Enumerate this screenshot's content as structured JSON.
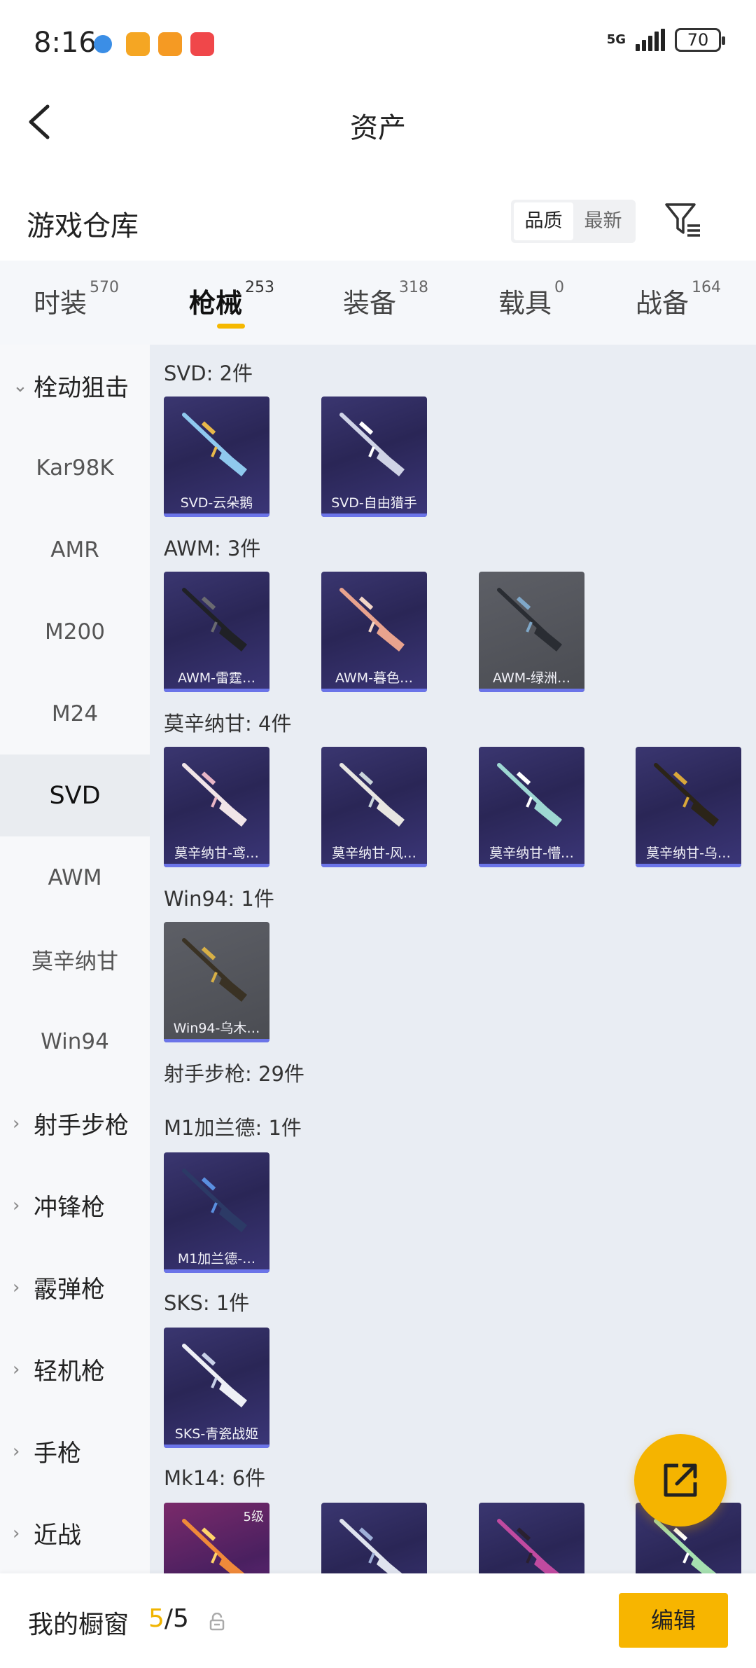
{
  "status": {
    "time": "8:16",
    "network": "5G",
    "battery": "70",
    "app_icons": [
      {
        "name": "browser-app-icon",
        "color": "#3b8ee6"
      },
      {
        "name": "yellow-app-icon",
        "color": "#f5a623"
      },
      {
        "name": "video-app-icon",
        "color": "#f59a23"
      },
      {
        "name": "red-app-icon",
        "color": "#f0474a"
      }
    ]
  },
  "nav": {
    "title": "资产"
  },
  "header": {
    "title": "游戏仓库",
    "sort_options": [
      "品质",
      "最新"
    ],
    "sort_selected": "品质"
  },
  "tabs": [
    {
      "label": "时装",
      "count": "570"
    },
    {
      "label": "枪械",
      "count": "253",
      "active": true
    },
    {
      "label": "装备",
      "count": "318"
    },
    {
      "label": "载具",
      "count": "0"
    },
    {
      "label": "战备",
      "count": "164"
    }
  ],
  "sidebar": {
    "expanded_category": "栓动狙击",
    "sub_items": [
      "Kar98K",
      "AMR",
      "M200",
      "M24",
      "SVD",
      "AWM",
      "莫辛纳甘",
      "Win94"
    ],
    "active_item": "SVD",
    "categories": [
      "射手步枪",
      "冲锋枪",
      "霰弹枪",
      "轻机枪",
      "手枪",
      "近战"
    ]
  },
  "groups": [
    {
      "label": "SVD: 2件",
      "items": [
        {
          "name": "SVD-云朵鹅",
          "tone": "purple",
          "gun": "#8fc9ee",
          "accent": "#e8b84a"
        },
        {
          "name": "SVD-自由猎手",
          "tone": "purple",
          "gun": "#cfd3e6",
          "accent": "#ffffff"
        }
      ]
    },
    {
      "label": "AWM: 3件",
      "items": [
        {
          "name": "AWM-雷霆…",
          "tone": "purple",
          "gun": "#202126",
          "accent": "#6a6a70"
        },
        {
          "name": "AWM-暮色…",
          "tone": "purple",
          "gun": "#e9a38e",
          "accent": "#f3d6c7"
        },
        {
          "name": "AWM-绿洲…",
          "tone": "gray",
          "gun": "#2a2d33",
          "accent": "#7fa7c8"
        }
      ]
    },
    {
      "label": "莫辛纳甘: 4件",
      "items": [
        {
          "name": "莫辛纳甘-鸢…",
          "tone": "purple",
          "gun": "#f1e5e8",
          "accent": "#e8b6c6"
        },
        {
          "name": "莫辛纳甘-风…",
          "tone": "purple",
          "gun": "#e8e6e2",
          "accent": "#c9d4da"
        },
        {
          "name": "莫辛纳甘-懵…",
          "tone": "purple",
          "gun": "#9ed8d3",
          "accent": "#ffffff"
        },
        {
          "name": "莫辛纳甘-乌…",
          "tone": "purple",
          "gun": "#2b2418",
          "accent": "#d9a83a"
        }
      ]
    },
    {
      "label": "Win94: 1件",
      "items": [
        {
          "name": "Win94-乌木…",
          "tone": "gray",
          "gun": "#3a3224",
          "accent": "#d8b046"
        }
      ]
    },
    {
      "label": "射手步枪: 29件",
      "items": []
    },
    {
      "label": "M1加兰德: 1件",
      "items": [
        {
          "name": "M1加兰德-…",
          "tone": "purple",
          "gun": "#2c3a66",
          "accent": "#5a8fe0"
        }
      ]
    },
    {
      "label": "SKS: 1件",
      "items": [
        {
          "name": "SKS-青瓷战姬",
          "tone": "purple",
          "gun": "#eef0f6",
          "accent": "#c8d0e8"
        }
      ]
    },
    {
      "label": "Mk14: 6件",
      "items": [
        {
          "name": "",
          "tone": "pink",
          "gun": "#f08a3a",
          "accent": "#ffd36a",
          "level": "5级"
        },
        {
          "name": "",
          "tone": "purple",
          "gun": "#dfe3ee",
          "accent": "#9fb0d8"
        },
        {
          "name": "",
          "tone": "purple",
          "gun": "#c04aa0",
          "accent": "#2a2030"
        },
        {
          "name": "",
          "tone": "purple",
          "gun": "#a6e0b0",
          "accent": "#ffffff"
        }
      ]
    }
  ],
  "bottom": {
    "label": "我的橱窗",
    "count_current": "5",
    "count_sep": "/5",
    "edit_label": "编辑"
  }
}
